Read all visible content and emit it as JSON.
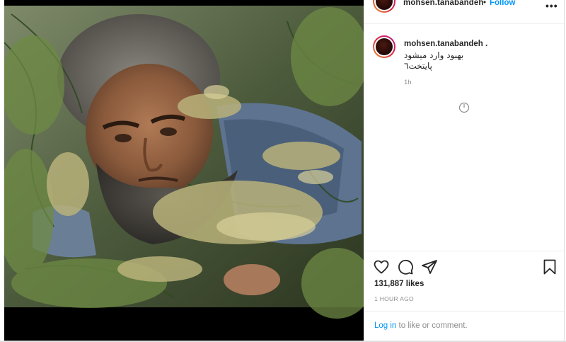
{
  "post": {
    "username": "mohsen.tanabandeh",
    "separator": "•",
    "follow_label": "Follow",
    "more_icon": "more-options-icon",
    "more_label": "•••",
    "caption": {
      "username": "mohsen.tanabandeh",
      "suffix": " .",
      "line1": "بهبود وارد میشود",
      "line2": "پایتخت٦",
      "time": "1h"
    },
    "likes": "131,887 likes",
    "time_ago": "1 HOUR AGO",
    "login": {
      "link": "Log in",
      "rest": " to like or comment."
    }
  },
  "icons": {
    "like": "heart-icon",
    "comment": "comment-bubble-icon",
    "share": "paper-plane-icon",
    "save": "bookmark-icon",
    "loading": "loading-spinner-icon"
  },
  "colors": {
    "accent": "#0095f6",
    "text": "#262626",
    "muted": "#8e8e8e",
    "border": "#efefef"
  }
}
